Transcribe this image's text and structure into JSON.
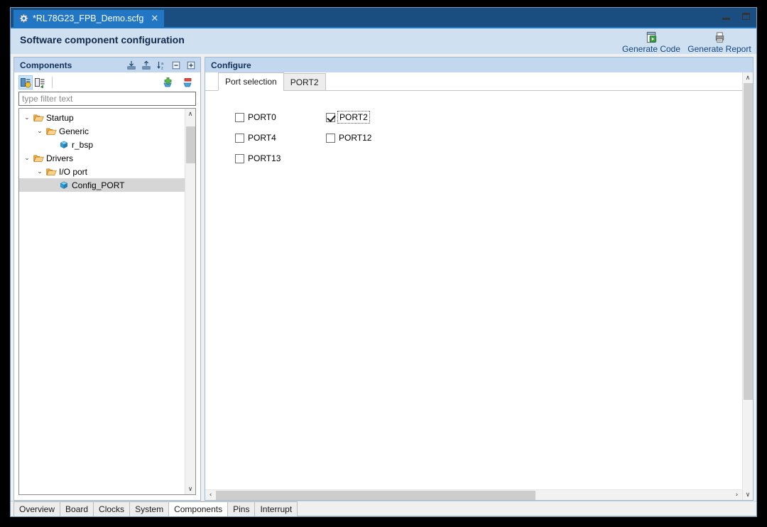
{
  "window": {
    "file_tab": {
      "icon": "gear-icon",
      "title": "*RL78G23_FPB_Demo.scfg",
      "close": "✕"
    },
    "controls": {
      "minimize": "minimize-icon",
      "maximize": "maximize-icon"
    }
  },
  "header": {
    "title": "Software component configuration",
    "actions": [
      {
        "label": "Generate Code",
        "icon": "generate-code-icon"
      },
      {
        "label": "Generate Report",
        "icon": "generate-report-icon"
      }
    ]
  },
  "components_view": {
    "title": "Components",
    "header_icons": [
      "import-icon",
      "export-icon",
      "sort-az-icon",
      "collapse-all-icon",
      "expand-all-icon"
    ],
    "toolbar": [
      {
        "name": "show-components-icon",
        "pressed": true
      },
      {
        "name": "show-hardware-icon",
        "pressed": false
      },
      {
        "name": "add-component-icon",
        "pressed": false
      },
      {
        "name": "remove-component-icon",
        "pressed": false
      }
    ],
    "filter": {
      "placeholder": "type filter text",
      "value": ""
    },
    "tree": [
      {
        "label": "Startup",
        "depth": 0,
        "twisty": "⌄",
        "icon": "folder-icon",
        "selected": false
      },
      {
        "label": "Generic",
        "depth": 1,
        "twisty": "⌄",
        "icon": "folder-icon",
        "selected": false
      },
      {
        "label": "r_bsp",
        "depth": 2,
        "twisty": "",
        "icon": "component-icon",
        "selected": false
      },
      {
        "label": "Drivers",
        "depth": 0,
        "twisty": "⌄",
        "icon": "folder-icon",
        "selected": false
      },
      {
        "label": "I/O port",
        "depth": 1,
        "twisty": "⌄",
        "icon": "folder-icon",
        "selected": false
      },
      {
        "label": "Config_PORT",
        "depth": 2,
        "twisty": "",
        "icon": "component-icon",
        "selected": true
      }
    ],
    "scrollbar": {
      "up": "∧",
      "down": "∨",
      "thumb_top_pct": 2,
      "thumb_height_pct": 10
    }
  },
  "configure_view": {
    "title": "Configure",
    "tabs": [
      {
        "label": "Port selection",
        "active": true
      },
      {
        "label": "PORT2",
        "active": false
      }
    ],
    "ports": [
      {
        "label": "PORT0",
        "checked": false,
        "focused": false
      },
      {
        "label": "PORT2",
        "checked": true,
        "focused": true
      },
      {
        "label": "PORT4",
        "checked": false,
        "focused": false
      },
      {
        "label": "PORT12",
        "checked": false,
        "focused": false
      },
      {
        "label": "PORT13",
        "checked": false,
        "focused": false
      }
    ],
    "v_scrollbar": {
      "up": "∧",
      "down": "∨",
      "thumb_top_pct": 0,
      "thumb_height_pct": 78
    },
    "h_scrollbar": {
      "left": "‹",
      "right": "›",
      "thumb_left_pct": 0,
      "thumb_width_pct": 62
    }
  },
  "bottom_tabs": [
    {
      "label": "Overview",
      "active": false
    },
    {
      "label": "Board",
      "active": false
    },
    {
      "label": "Clocks",
      "active": false
    },
    {
      "label": "System",
      "active": false
    },
    {
      "label": "Components",
      "active": true
    },
    {
      "label": "Pins",
      "active": false
    },
    {
      "label": "Interrupt",
      "active": false
    }
  ],
  "colors": {
    "tab_blue": "#2277c4",
    "header_blue": "#cfe0f0",
    "view_header_blue": "#c3d8ee",
    "link_blue": "#13457e",
    "selection_gray": "#d6d6d6"
  }
}
